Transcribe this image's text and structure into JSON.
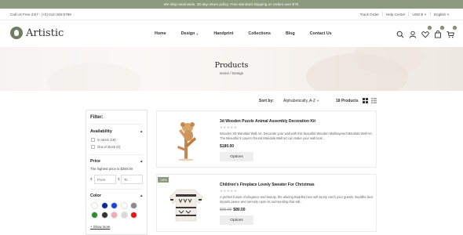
{
  "announcement": "We ship nationwide. 30-day return policy. Free standard shipping on orders over $75.",
  "utility": {
    "contact": "Call Us Free 24/7 : (+0) 012-345-6789",
    "track_order": "Track Order",
    "help_center": "Help Center",
    "currency": "USD $",
    "language": "English"
  },
  "brand": {
    "name": "Artistic"
  },
  "nav": [
    "Home",
    "Design",
    "Handprint",
    "Collections",
    "Blog",
    "Contact Us"
  ],
  "header_icons": {
    "compare_count": "0",
    "wishlist_count": "0",
    "cart_count": "0"
  },
  "hero": {
    "title": "Products",
    "breadcrumb": "Home / Design"
  },
  "toolbar": {
    "sort_label": "Sort by:",
    "sort_value": "Alphabetically, A-Z",
    "count": "18 Products"
  },
  "filter": {
    "title": "Filter:",
    "availability": {
      "label": "Availability",
      "options": [
        "In stock (18)",
        "Out of stock (0)"
      ]
    },
    "price": {
      "label": "Price",
      "note": "The highest price is $250.00",
      "currency": "$",
      "from_placeholder": "From",
      "to_placeholder": "To"
    },
    "color": {
      "label": "Color",
      "swatches": [
        "#ffffff",
        "#0b2a8a",
        "#1a45d8",
        "#ffffff",
        "#8a8a8a",
        "#2a8c2a",
        "#333333",
        "#f4a9b8",
        "#d9d9d9",
        "#e01818"
      ],
      "show_more": "+ Show more"
    }
  },
  "products": [
    {
      "title": "3d Wooden Puzzle Animal Assembly Decoration Kit",
      "stars": "★★★★★",
      "description": "Wooden 3D Mandala Wall Art. Decorate your wall with this beautiful Wooden Multilayered Mandala Wall Art. The Beautiful 8 Layers Round Mandala Wall art can make your wall look...",
      "price": "$180.00",
      "button": "Options"
    },
    {
      "badge": "-18%",
      "title": "Children's Fireplace Lovely Sweater For Christmas",
      "stars": "★★★★★",
      "description": "A perfect fusion of elegance and beauty, the alluring Buddha face will surely catch your guests. Buddha face imparts peace and serenity upon its surrounding that will...",
      "old_price": "$95.00",
      "price": "$80.00",
      "button": "Options"
    }
  ]
}
